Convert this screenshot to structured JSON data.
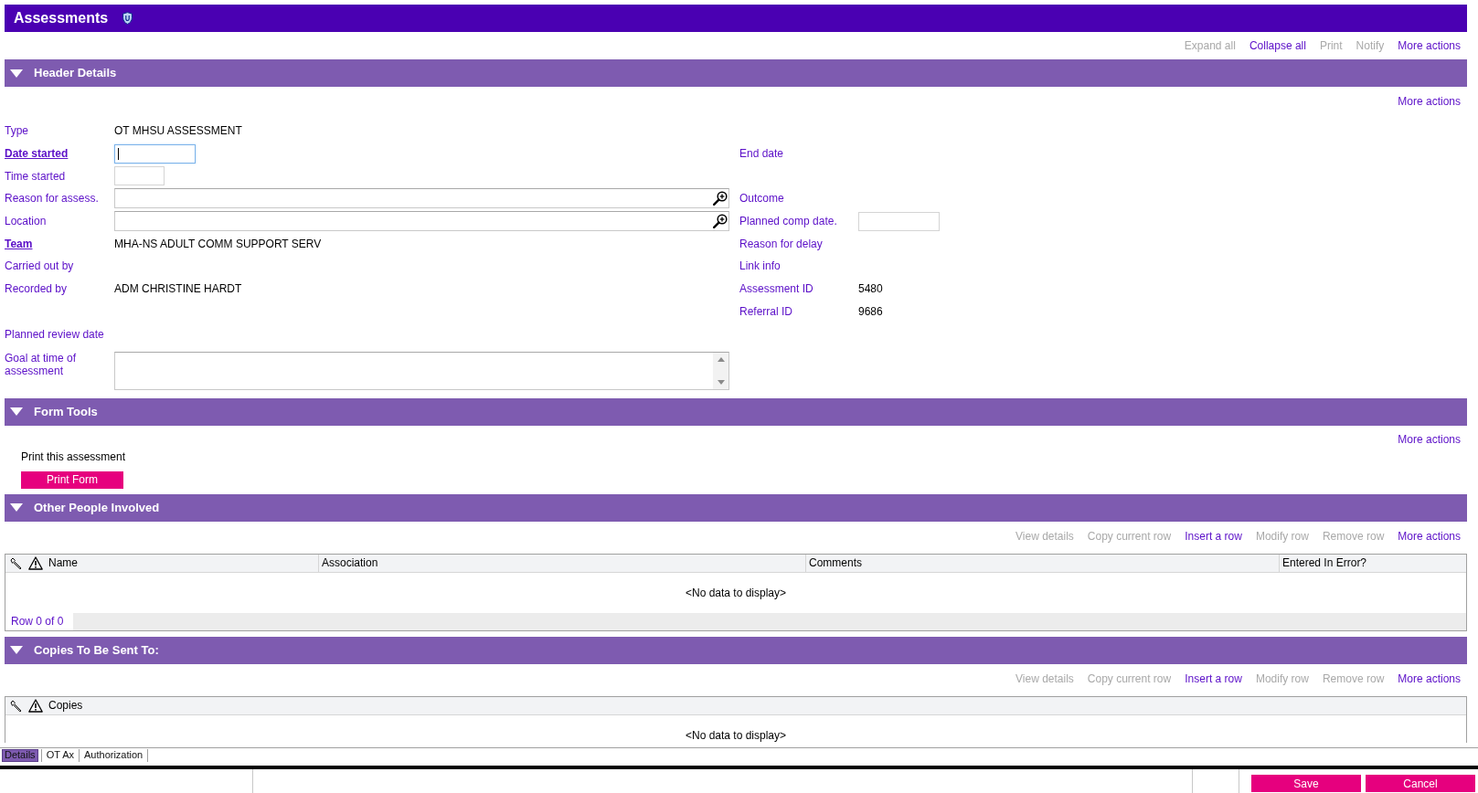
{
  "page_title": "Assessments",
  "page_actions": [
    {
      "label": "Expand all",
      "disabled": true
    },
    {
      "label": "Collapse all",
      "disabled": false
    },
    {
      "label": "Print",
      "disabled": true
    },
    {
      "label": "Notify",
      "disabled": true
    },
    {
      "label": "More actions",
      "disabled": false
    }
  ],
  "sections": [
    {
      "kind": "details",
      "title": "Header Details",
      "expanded": true,
      "actions": [
        {
          "label": "More actions",
          "disabled": false
        }
      ],
      "rows": [
        {
          "left": {
            "label": "Type",
            "link": false,
            "kind": "text",
            "value": "OT MHSU ASSESSMENT"
          }
        },
        {
          "left": {
            "label": "Date started",
            "link": true,
            "kind": "date",
            "focused": true
          },
          "right": {
            "label": "End date",
            "link": false,
            "kind": "text"
          }
        },
        {
          "left": {
            "label": "Time started",
            "link": false,
            "kind": "time",
            "focused": false
          }
        },
        {
          "left": {
            "label": "Reason for assess.",
            "link": false,
            "kind": "lookup",
            "focused": false
          },
          "right": {
            "label": "Outcome",
            "link": false,
            "kind": "text"
          }
        },
        {
          "left": {
            "label": "Location",
            "link": false,
            "kind": "lookup",
            "focused": false
          },
          "right": {
            "label": "Planned comp date.",
            "link": false,
            "kind": "date",
            "focused": false
          }
        },
        {
          "left": {
            "label": "Team",
            "link": true,
            "kind": "text",
            "value": "MHA-NS ADULT COMM SUPPORT SERV"
          },
          "right": {
            "label": "Reason for delay",
            "link": false,
            "kind": "text"
          }
        },
        {
          "left": {
            "label": "Carried out by",
            "link": false,
            "kind": "text"
          },
          "right": {
            "label": "Link info",
            "link": false,
            "kind": "text"
          }
        },
        {
          "left": {
            "label": "Recorded by",
            "link": false,
            "kind": "text",
            "value": "ADM CHRISTINE HARDT"
          },
          "right": {
            "label": "Assessment ID",
            "link": false,
            "kind": "text",
            "value": "5480"
          }
        },
        {
          "right": {
            "label": "Referral ID",
            "link": false,
            "kind": "text",
            "value": "9686"
          }
        },
        {
          "left": {
            "label": "Planned review date",
            "link": false,
            "kind": "text"
          }
        },
        {
          "left": {
            "label": "Goal at time of assessment",
            "link": false,
            "kind": "textarea",
            "focused": false
          }
        }
      ]
    },
    {
      "kind": "tools",
      "title": "Form Tools",
      "expanded": true,
      "actions": [
        {
          "label": "More actions",
          "disabled": false
        }
      ],
      "caption": "Print this assessment",
      "button": "Print Form"
    },
    {
      "kind": "table",
      "title": "Other People Involved",
      "expanded": true,
      "actions": [
        {
          "label": "View details",
          "disabled": true
        },
        {
          "label": "Copy current row",
          "disabled": true
        },
        {
          "label": "Insert a row",
          "disabled": false
        },
        {
          "label": "Modify row",
          "disabled": true
        },
        {
          "label": "Remove row",
          "disabled": true
        },
        {
          "label": "More actions",
          "disabled": false
        }
      ],
      "table": {
        "columns": [
          "Name",
          "Association",
          "Comments",
          "Entered In Error?"
        ],
        "empty_message": "<No data to display>",
        "footer": "Row 0 of 0"
      }
    },
    {
      "kind": "table",
      "title": "Copies To Be Sent To:",
      "expanded": true,
      "actions": [
        {
          "label": "View details",
          "disabled": true
        },
        {
          "label": "Copy current row",
          "disabled": true
        },
        {
          "label": "Insert a row",
          "disabled": false
        },
        {
          "label": "Modify row",
          "disabled": true
        },
        {
          "label": "Remove row",
          "disabled": true
        },
        {
          "label": "More actions",
          "disabled": false
        }
      ],
      "table": {
        "columns": [
          "Copies"
        ],
        "empty_message": "<No data to display>"
      }
    }
  ],
  "tabs": [
    {
      "label": "Details",
      "selected": true
    },
    {
      "label": "OT Ax",
      "selected": false
    },
    {
      "label": "Authorization",
      "selected": false
    }
  ],
  "buttons": [
    "Save",
    "Cancel"
  ]
}
